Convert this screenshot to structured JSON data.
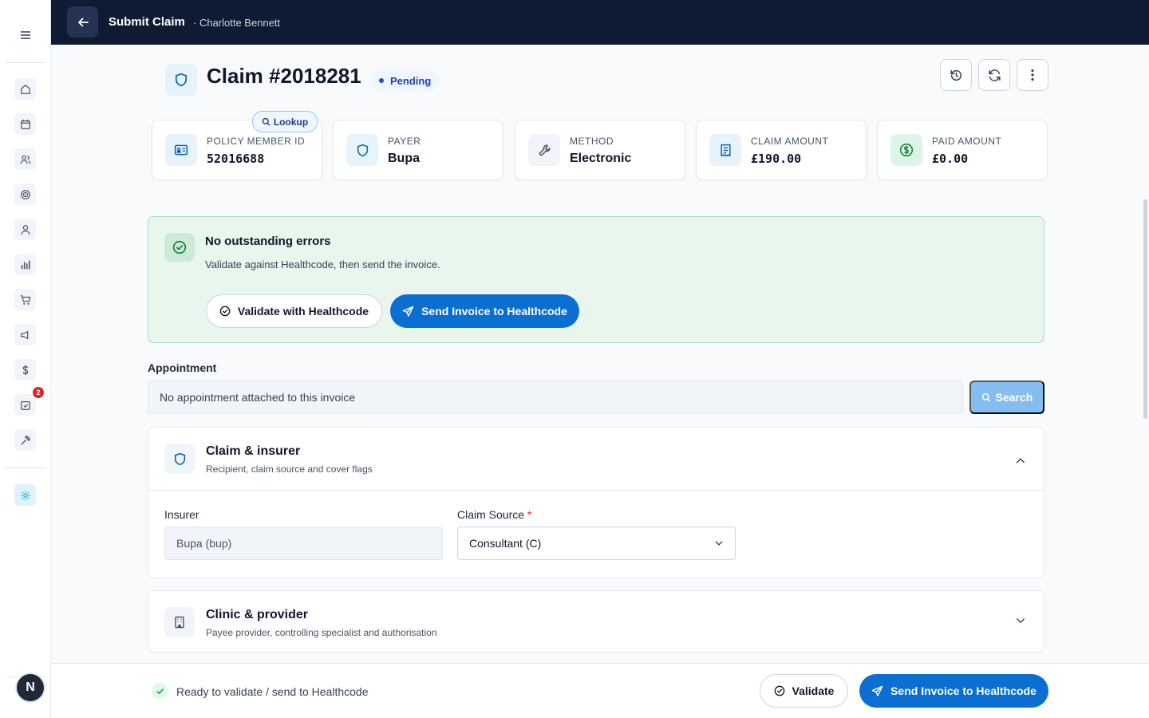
{
  "topbar": {
    "title": "Submit Claim",
    "subtitle": "· Charlotte Bennett"
  },
  "sidebar": {
    "notification_count": "2",
    "avatar_letter": "N"
  },
  "claim": {
    "title": "Claim #2018281",
    "status": "Pending"
  },
  "stats": {
    "lookup_label": "Lookup",
    "policy": {
      "label": "Policy Member ID",
      "value": "52016688"
    },
    "payer": {
      "label": "Payer",
      "value": "Bupa"
    },
    "method": {
      "label": "Method",
      "value": "Electronic"
    },
    "claim_amount": {
      "label": "Claim Amount",
      "value": "£190.00"
    },
    "paid_amount": {
      "label": "Paid Amount",
      "value": "£0.00"
    }
  },
  "alert": {
    "title": "No outstanding errors",
    "description": "Validate against Healthcode, then send the invoice.",
    "validate_label": "Validate with Healthcode",
    "send_label": "Send Invoice to Healthcode"
  },
  "appointment": {
    "label": "Appointment",
    "value": "No appointment attached to this invoice",
    "search_label": "Search"
  },
  "claim_section": {
    "title": "Claim & insurer",
    "subtitle": "Recipient, claim source and cover flags",
    "insurer_label": "Insurer",
    "insurer_value": "Bupa (bup)",
    "source_label": "Claim Source",
    "source_required": "*",
    "source_value": "Consultant (C)"
  },
  "clinic_section": {
    "title": "Clinic & provider",
    "subtitle": "Payee provider, controlling specialist and authorisation"
  },
  "footer": {
    "status": "Ready to validate / send to Healthcode",
    "validate_label": "Validate",
    "send_label": "Send Invoice to Healthcode"
  },
  "colors": {
    "primary": "#0b6fd1",
    "topbar": "#0f1b33",
    "success_bg": "#e8f6ee",
    "success": "#16a34a"
  }
}
